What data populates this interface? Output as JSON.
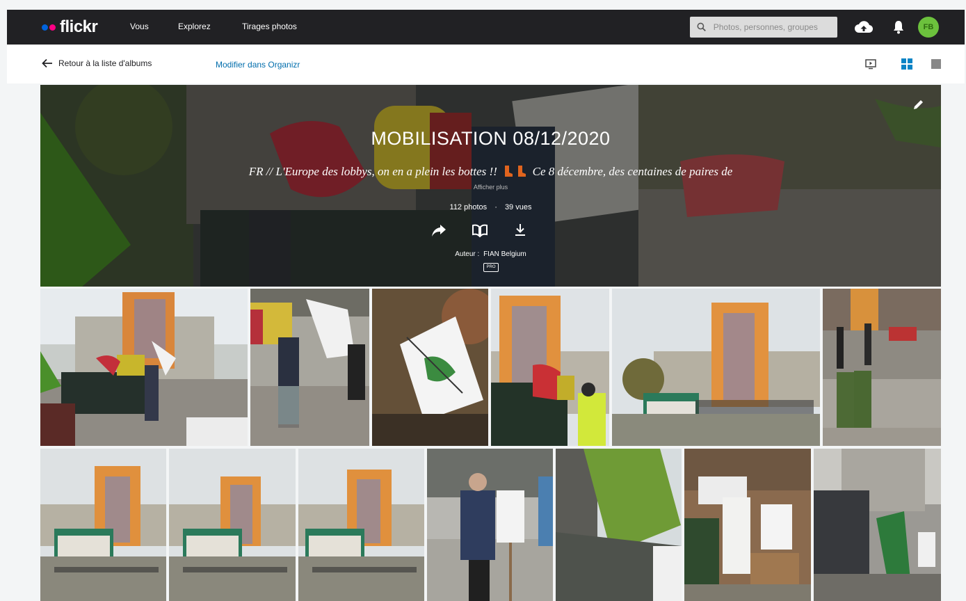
{
  "header": {
    "logo": "flickr",
    "nav": [
      "Vous",
      "Explorez",
      "Tirages photos"
    ],
    "search_placeholder": "Photos, personnes, groupes",
    "avatar_initials": "FB",
    "logo_dot_colors": [
      "#0063dc",
      "#ff0084"
    ]
  },
  "subnav": {
    "back_label": "Retour à la liste d'albums",
    "organizr_label": "Modifier dans Organizr",
    "view_icons": [
      "slideshow-icon",
      "grid-view-icon",
      "square-view-icon"
    ]
  },
  "album": {
    "title": "MOBILISATION 08/12/2020",
    "description_before": "FR // L'Europe des lobbys, on en a plein les bottes !!",
    "description_after": "Ce 8 décembre, des centaines de paires de",
    "more_label": "Afficher plus",
    "photo_count": "112 photos",
    "stats_separator": "·",
    "view_count": "39 vues",
    "author_label": "Auteur :",
    "author_name": "FIAN Belgium",
    "pro_badge": "PRO"
  },
  "colors": {
    "topbar": "#212124",
    "link": "#006dac",
    "avatar": "#6cc13d",
    "accent_blue": "#0063dc"
  }
}
